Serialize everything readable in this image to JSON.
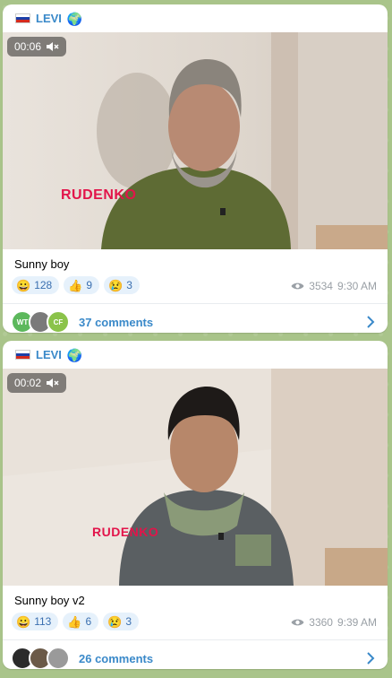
{
  "posts": [
    {
      "channel": "LEVI",
      "header_icons": [
        "russia-flag-icon",
        "globe-icon"
      ],
      "media": {
        "duration": "00:06",
        "muted": true,
        "watermark": "RUDENKO"
      },
      "caption": "Sunny boy",
      "reactions": [
        {
          "emoji": "😀",
          "icon": "grinning-face-icon",
          "count": "128"
        },
        {
          "emoji": "👍",
          "icon": "thumbs-up-icon",
          "count": "9"
        },
        {
          "emoji": "😢",
          "icon": "crying-face-icon",
          "count": "3"
        }
      ],
      "views": "3534",
      "time": "9:30 AM",
      "commenters": [
        "WT",
        "",
        "CF"
      ],
      "comments_label": "37 comments"
    },
    {
      "channel": "LEVI",
      "header_icons": [
        "russia-flag-icon",
        "globe-icon"
      ],
      "media": {
        "duration": "00:02",
        "muted": true,
        "watermark": "RUDENKO"
      },
      "caption": "Sunny boy v2",
      "reactions": [
        {
          "emoji": "😀",
          "icon": "grinning-face-icon",
          "count": "113"
        },
        {
          "emoji": "👍",
          "icon": "thumbs-up-icon",
          "count": "6"
        },
        {
          "emoji": "😢",
          "icon": "crying-face-icon",
          "count": "3"
        }
      ],
      "views": "3360",
      "time": "9:39 AM",
      "commenters": [
        "",
        "",
        ""
      ],
      "comments_label": "26 comments"
    }
  ],
  "colors": {
    "accent": "#3a89c9",
    "watermark": "#e2144a",
    "reaction_bg": "#e6f1fb",
    "meta_gray": "#9aa0a6",
    "chat_bg": "#a9c48a"
  }
}
